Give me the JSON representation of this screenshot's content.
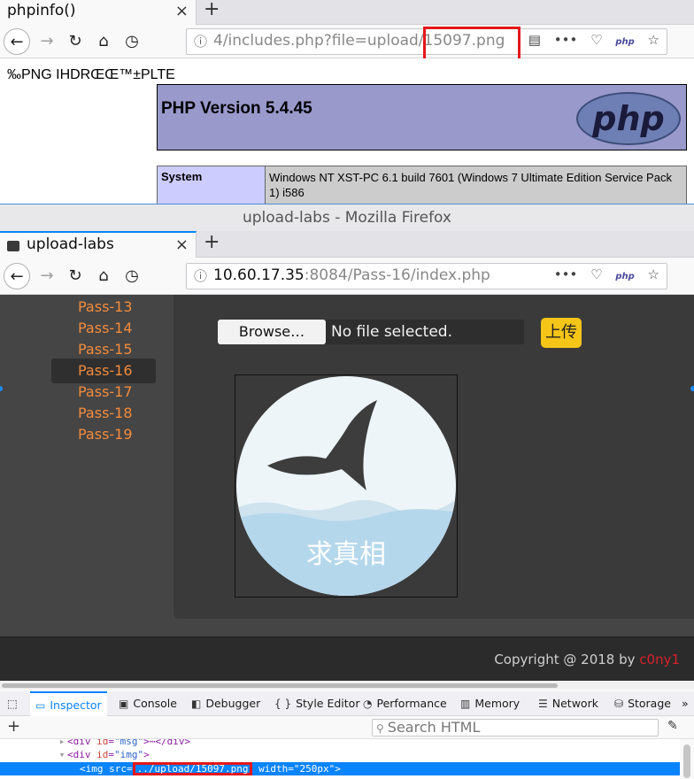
{
  "window1": {
    "tab_title": "phpinfo()",
    "tab_close": "×",
    "new_tab": "+",
    "url_prefix": "4/includes.php?file=upload/",
    "url_file": "15097.png",
    "png_header_text": "‰PNG  IHDRŒŒ™±PLTE",
    "php_version": "PHP Version 5.4.45",
    "php_logo_text": "php",
    "table": {
      "system_key": "System",
      "system_value": "Windows NT XST-PC 6.1 build 7601 (Windows 7 Ultimate Edition Service Pack 1) i586"
    }
  },
  "window2": {
    "window_title": "upload-labs - Mozilla Firefox",
    "tab_title": "upload-labs",
    "tab_close": "×",
    "new_tab": "+",
    "url_host": "10.60.17.35",
    "url_rest": ":8084/Pass-16/index.php"
  },
  "nav_icons": {
    "back": "←",
    "forward": "→",
    "reload": "↻",
    "home": "⌂",
    "history": "◷",
    "info": "ⓘ",
    "reader": "▤",
    "more": "•••",
    "pocket": "♡",
    "php_ext": "php",
    "star": "☆"
  },
  "sidebar": {
    "items": [
      {
        "label": "Pass-13"
      },
      {
        "label": "Pass-14"
      },
      {
        "label": "Pass-15"
      },
      {
        "label": "Pass-16",
        "active": true
      },
      {
        "label": "Pass-17"
      },
      {
        "label": "Pass-18"
      },
      {
        "label": "Pass-19"
      }
    ]
  },
  "upload_form": {
    "browse_label": "Browse…",
    "file_status": "No file selected.",
    "submit_label": "上传"
  },
  "uploaded_image": {
    "caption": "求真相"
  },
  "footer": {
    "copyright_prefix": "Copyright @ 2018 by ",
    "author": "c0ny1"
  },
  "devtools": {
    "tabs": [
      {
        "label": "Inspector",
        "icon": "▭",
        "active": true
      },
      {
        "label": "Console",
        "icon": "▣"
      },
      {
        "label": "Debugger",
        "icon": "◧"
      },
      {
        "label": "Style Editor",
        "icon": "{ }"
      },
      {
        "label": "Performance",
        "icon": "◔"
      },
      {
        "label": "Memory",
        "icon": "▥"
      },
      {
        "label": "Network",
        "icon": "☰"
      },
      {
        "label": "Storage",
        "icon": "⛁"
      }
    ],
    "overflow": "»",
    "picker_icon": "⬚",
    "add_node": "+",
    "search_placeholder": "Search HTML",
    "markup": {
      "line1_tag": "<div ",
      "line1_attr": "id",
      "line1_val": "\"msg\"",
      "line1_rest": ">⋯</div>",
      "line2_tag": "<div ",
      "line2_attr": "id",
      "line2_val": "\"img\"",
      "line2_rest": ">",
      "line3_tag": "<img ",
      "line3_attr": "src",
      "line3_src": "../upload/15097.png",
      "line3_attr2": "width",
      "line3_val2": "\"250px\"",
      "line3_rest": ">"
    }
  },
  "colors": {
    "accent": "#0a84ff",
    "highlight_red": "#e4171a",
    "sidebar_link": "#f28b3c",
    "upload_button": "#f5c518",
    "php_purple": "#9999cc"
  }
}
